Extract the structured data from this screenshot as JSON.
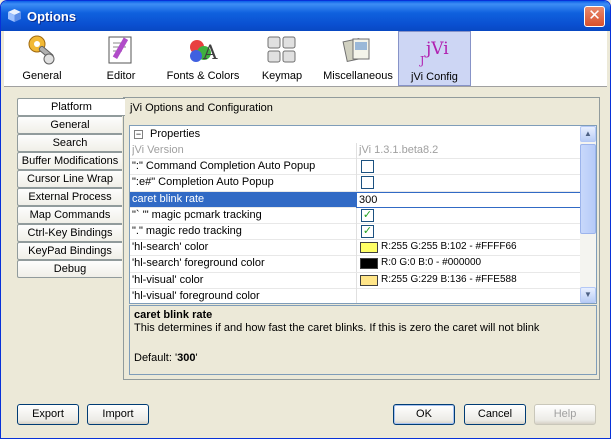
{
  "window": {
    "title": "Options"
  },
  "toolbar": [
    {
      "label": "General",
      "icon": "gears-icon"
    },
    {
      "label": "Editor",
      "icon": "editor-icon"
    },
    {
      "label": "Fonts & Colors",
      "icon": "fonts-colors-icon"
    },
    {
      "label": "Keymap",
      "icon": "keymap-icon"
    },
    {
      "label": "Miscellaneous",
      "icon": "miscellaneous-icon"
    },
    {
      "label": "jVi Config",
      "icon": "jvi-icon",
      "icon_text": "jVi",
      "selected": true
    }
  ],
  "side_tabs": [
    {
      "label": "Platform",
      "active": true
    },
    {
      "label": "General"
    },
    {
      "label": "Search"
    },
    {
      "label": "Buffer Modifications"
    },
    {
      "label": "Cursor Line Wrap"
    },
    {
      "label": "External Process"
    },
    {
      "label": "Map Commands"
    },
    {
      "label": "Ctrl-Key Bindings"
    },
    {
      "label": "KeyPad Bindings"
    },
    {
      "label": "Debug"
    }
  ],
  "panel": {
    "heading": "jVi Options and Configuration",
    "properties_label": "Properties",
    "rows": [
      {
        "name": "jVi Version",
        "value": "jVi 1.3.1.beta8.2",
        "kind": "text",
        "disabled": true
      },
      {
        "name": "\":\" Command Completion Auto Popup",
        "kind": "checkbox",
        "checked": false
      },
      {
        "name": "\":e#\" Completion Auto Popup",
        "kind": "checkbox",
        "checked": false
      },
      {
        "name": "caret blink rate",
        "value": "300",
        "kind": "edit",
        "selected": true
      },
      {
        "name": "\"` '\" magic pcmark tracking",
        "kind": "checkbox",
        "checked": true
      },
      {
        "name": "\".\" magic redo tracking",
        "kind": "checkbox",
        "checked": true
      },
      {
        "name": "'hl-search' color",
        "kind": "color",
        "color": "#FFFF66",
        "value": "R:255 G:255 B:102 - #FFFF66"
      },
      {
        "name": "'hl-search' foreground color",
        "kind": "color",
        "color": "#000000",
        "value": "R:0 G:0 B:0 - #000000"
      },
      {
        "name": "'hl-visual' color",
        "kind": "color",
        "color": "#FFE588",
        "value": "R:255 G:229 B:136 - #FFE588"
      },
      {
        "name": "'hl-visual' foreground color",
        "kind": "text",
        "value": ""
      }
    ],
    "description": {
      "title": "caret blink rate",
      "text": "This determines if and how fast the caret blinks. If this is zero the caret will not blink",
      "default_prefix": "Default: '",
      "default_value": "300",
      "default_suffix": "'"
    }
  },
  "buttons": {
    "export": "Export",
    "import": "Import",
    "ok": "OK",
    "cancel": "Cancel",
    "help": "Help"
  },
  "colors": {
    "titlebar": "#0a4fd0",
    "selection": "#316ac5",
    "panel_bg": "#ece9d8"
  }
}
